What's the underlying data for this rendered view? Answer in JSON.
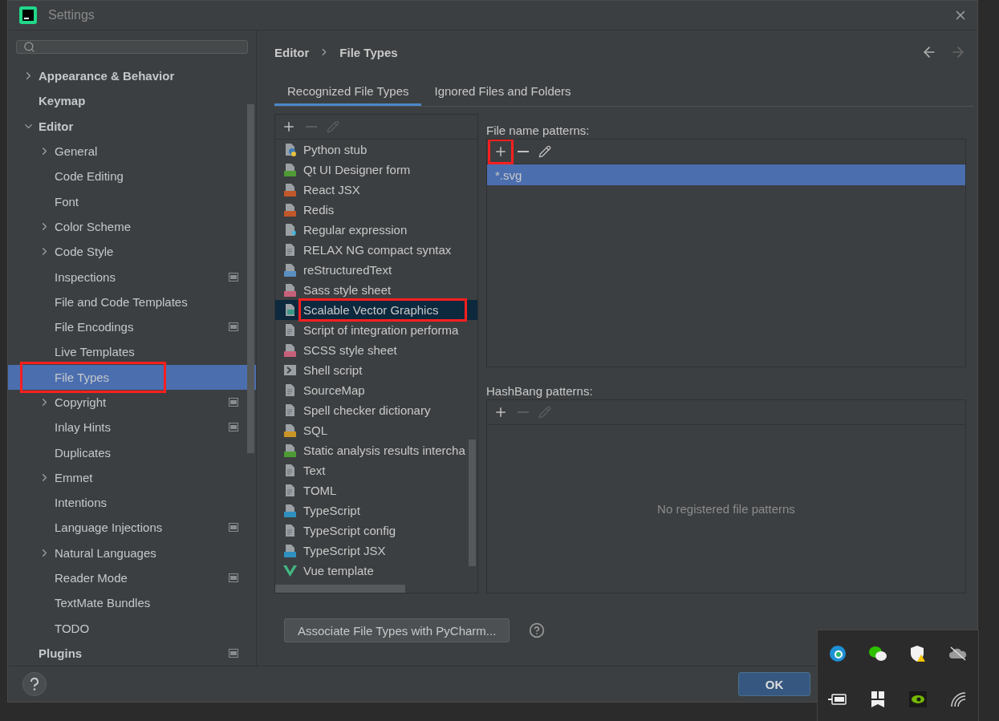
{
  "window": {
    "title": "Settings"
  },
  "sidebar": {
    "items": [
      {
        "label": "Appearance & Behavior",
        "expanded": false
      },
      {
        "label": "Keymap"
      },
      {
        "label": "Editor",
        "expanded": true,
        "children": [
          {
            "label": "General",
            "expanded": false
          },
          {
            "label": "Code Editing"
          },
          {
            "label": "Font"
          },
          {
            "label": "Color Scheme",
            "expanded": false
          },
          {
            "label": "Code Style",
            "expanded": false
          },
          {
            "label": "Inspections",
            "project_scope": true
          },
          {
            "label": "File and Code Templates"
          },
          {
            "label": "File Encodings",
            "project_scope": true
          },
          {
            "label": "Live Templates"
          },
          {
            "label": "File Types",
            "selected": true,
            "annotated": true
          },
          {
            "label": "Copyright",
            "expanded": false,
            "project_scope": true
          },
          {
            "label": "Inlay Hints",
            "project_scope": true
          },
          {
            "label": "Duplicates"
          },
          {
            "label": "Emmet",
            "expanded": false
          },
          {
            "label": "Intentions"
          },
          {
            "label": "Language Injections",
            "project_scope": true
          },
          {
            "label": "Natural Languages",
            "expanded": false
          },
          {
            "label": "Reader Mode",
            "project_scope": true
          },
          {
            "label": "TextMate Bundles"
          },
          {
            "label": "TODO"
          }
        ]
      },
      {
        "label": "Plugins",
        "project_scope": true
      }
    ]
  },
  "breadcrumb": [
    "Editor",
    "File Types"
  ],
  "tabs": [
    {
      "label": "Recognized File Types",
      "selected": true
    },
    {
      "label": "Ignored Files and Folders",
      "selected": false
    }
  ],
  "file_types": [
    {
      "label": "Python stub",
      "kind": "python",
      "selected": false
    },
    {
      "label": "Qt UI Designer form",
      "kind": "badge",
      "color": "#4e9a35",
      "selected": false
    },
    {
      "label": "React JSX",
      "kind": "badge",
      "color": "#c0582a",
      "selected": false
    },
    {
      "label": "Redis",
      "kind": "badge",
      "color": "#c0582a",
      "selected": false
    },
    {
      "label": "Regular expression",
      "kind": "regex",
      "selected": false
    },
    {
      "label": "RELAX NG compact syntax",
      "kind": "plain",
      "selected": false
    },
    {
      "label": "reStructuredText",
      "kind": "badge",
      "color": "#5a8fc2",
      "selected": false
    },
    {
      "label": "Sass style sheet",
      "kind": "badge",
      "color": "#c7607a",
      "selected": false
    },
    {
      "label": "Scalable Vector Graphics",
      "kind": "image",
      "selected": true,
      "annotated": true
    },
    {
      "label": "Script of integration performa",
      "kind": "plain",
      "selected": false
    },
    {
      "label": "SCSS style sheet",
      "kind": "badge",
      "color": "#c7607a",
      "selected": false
    },
    {
      "label": "Shell script",
      "kind": "shell",
      "selected": false
    },
    {
      "label": "SourceMap",
      "kind": "plain",
      "selected": false
    },
    {
      "label": "Spell checker dictionary",
      "kind": "plain",
      "selected": false
    },
    {
      "label": "SQL",
      "kind": "badge",
      "color": "#c99526",
      "selected": false
    },
    {
      "label": "Static analysis results intercha",
      "kind": "badge",
      "color": "#4e9a35",
      "selected": false
    },
    {
      "label": "Text",
      "kind": "plain",
      "selected": false
    },
    {
      "label": "TOML",
      "kind": "plain",
      "selected": false
    },
    {
      "label": "TypeScript",
      "kind": "badge",
      "color": "#2f8fbf",
      "selected": false
    },
    {
      "label": "TypeScript config",
      "kind": "plain",
      "selected": false
    },
    {
      "label": "TypeScript JSX",
      "kind": "badge",
      "color": "#2f8fbf",
      "selected": false
    },
    {
      "label": "Vue template",
      "kind": "vue",
      "selected": false
    }
  ],
  "file_name_patterns": {
    "label": "File name patterns:",
    "add_annotated": true,
    "items": [
      {
        "label": "*.svg",
        "selected": true
      }
    ]
  },
  "hashbang_patterns": {
    "label": "HashBang patterns:",
    "empty_text": "No registered file patterns"
  },
  "associate_button": "Associate File Types with PyCharm...",
  "ok_button": "OK"
}
